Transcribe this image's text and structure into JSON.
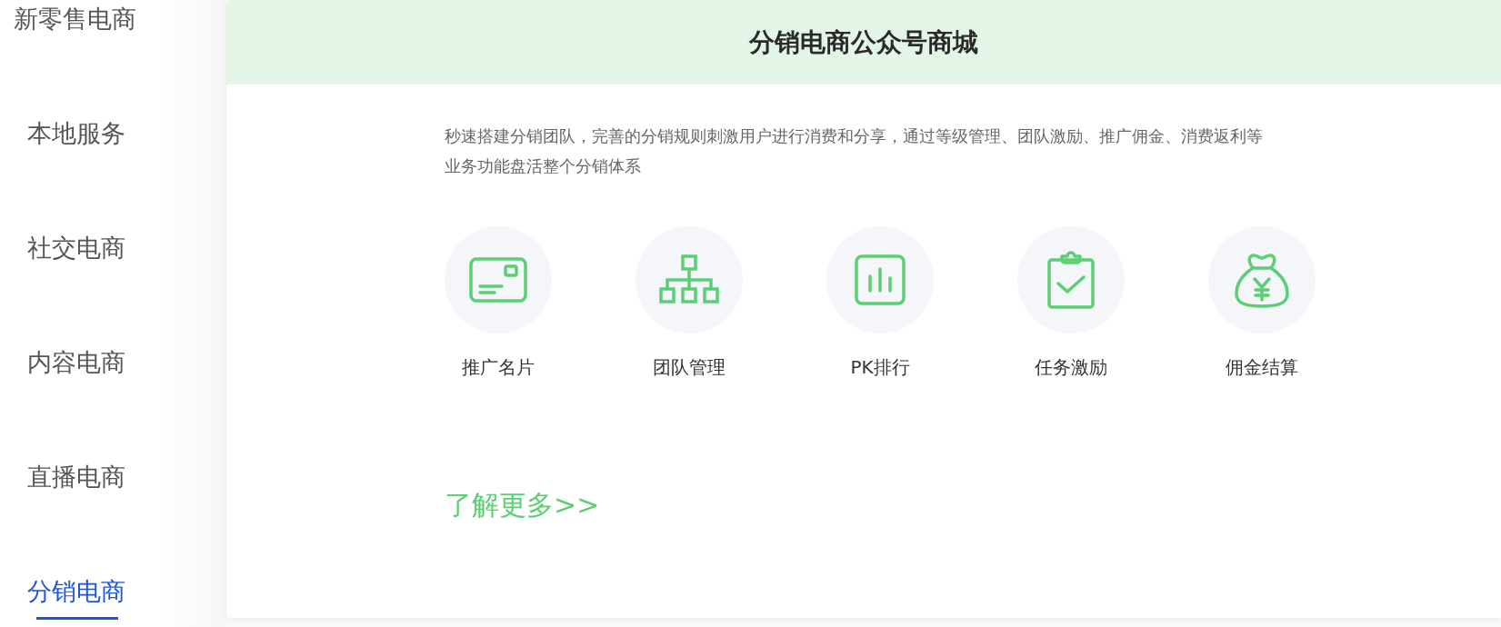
{
  "sidebar": {
    "items": [
      {
        "label": "新零售电商",
        "selected": false
      },
      {
        "label": "本地服务",
        "selected": false
      },
      {
        "label": "社交电商",
        "selected": false
      },
      {
        "label": "内容电商",
        "selected": false
      },
      {
        "label": "直播电商",
        "selected": false
      },
      {
        "label": "分销电商",
        "selected": true
      }
    ]
  },
  "card": {
    "title": "分销电商公众号商城",
    "description": "秒速搭建分销团队，完善的分销规则刺激用户进行消费和分享，通过等级管理、团队激励、推广佣金、消费返利等业务功能盘活整个分销体系",
    "features": [
      {
        "kind": "card",
        "label": "推广名片"
      },
      {
        "kind": "org",
        "label": "团队管理"
      },
      {
        "kind": "chart",
        "label": "PK排行"
      },
      {
        "kind": "clipboard",
        "label": "任务激励"
      },
      {
        "kind": "moneybag",
        "label": "佣金结算"
      }
    ],
    "link": "了解更多>>"
  }
}
